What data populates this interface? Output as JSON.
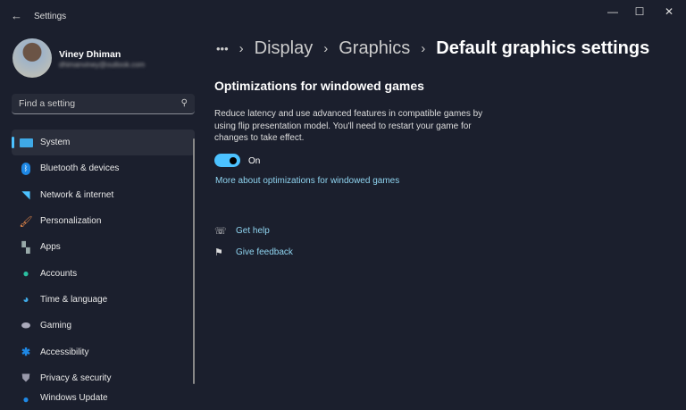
{
  "window": {
    "title": "Settings",
    "back_icon": "arrow-left-icon",
    "minimize": "—",
    "maximize": "☐",
    "close": "✕"
  },
  "user": {
    "name": "Viney Dhiman",
    "email": "dhimanviney@outlook.com"
  },
  "search": {
    "placeholder": "Find a setting",
    "icon": "search-icon"
  },
  "sidebar": {
    "items": [
      {
        "label": "System",
        "icon": "monitor-icon",
        "selected": true
      },
      {
        "label": "Bluetooth & devices",
        "icon": "bluetooth-icon"
      },
      {
        "label": "Network & internet",
        "icon": "wifi-icon"
      },
      {
        "label": "Personalization",
        "icon": "brush-icon"
      },
      {
        "label": "Apps",
        "icon": "apps-icon"
      },
      {
        "label": "Accounts",
        "icon": "person-icon"
      },
      {
        "label": "Time & language",
        "icon": "clock-globe-icon"
      },
      {
        "label": "Gaming",
        "icon": "gamepad-icon"
      },
      {
        "label": "Accessibility",
        "icon": "accessibility-icon"
      },
      {
        "label": "Privacy & security",
        "icon": "shield-icon"
      },
      {
        "label": "Windows Update",
        "icon": "update-icon"
      }
    ]
  },
  "breadcrumb": {
    "more": "•••",
    "items": [
      "Display",
      "Graphics",
      "Default graphics settings"
    ]
  },
  "main": {
    "heading": "Optimizations for windowed games",
    "description": "Reduce latency and use advanced features in compatible games by using flip presentation model. You'll need to restart your game for changes to take effect.",
    "toggle": {
      "state": "On",
      "on": true
    },
    "more_link": "More about optimizations for windowed games",
    "get_help": "Get help",
    "give_feedback": "Give feedback"
  },
  "colors": {
    "accent": "#4cc2ff",
    "background": "#1b1f2d",
    "link": "#8fd4f0"
  }
}
